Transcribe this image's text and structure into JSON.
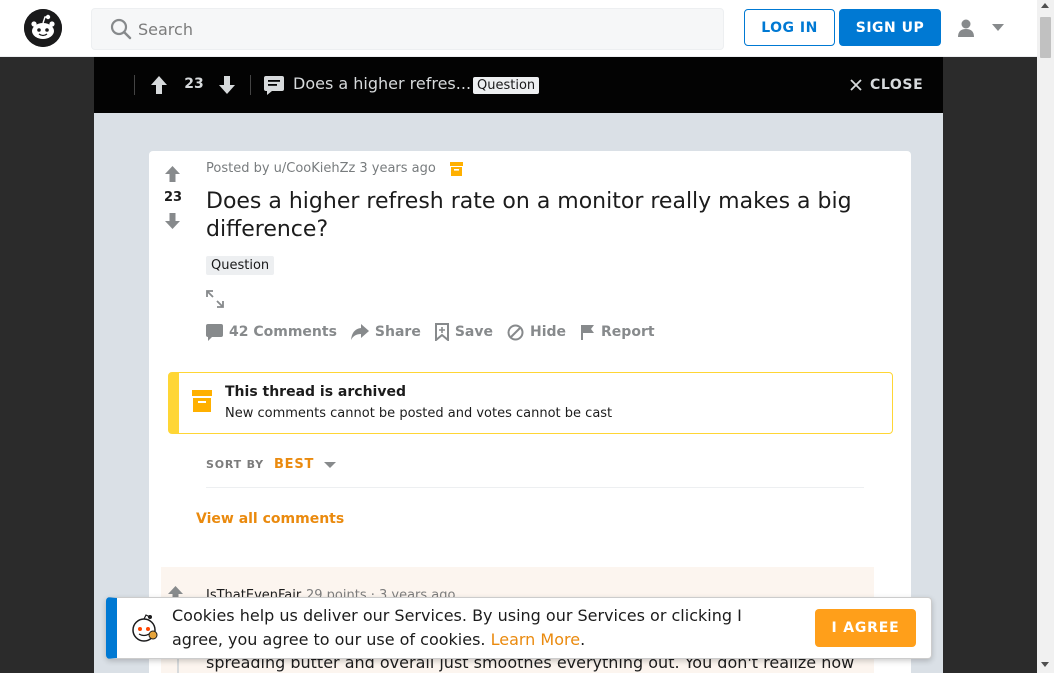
{
  "header": {
    "search_placeholder": "Search",
    "login_label": "LOG IN",
    "signup_label": "SIGN UP"
  },
  "postbar": {
    "score": "23",
    "title": "Does a higher refres...",
    "flair": "Question",
    "close_label": "CLOSE"
  },
  "post": {
    "posted_by": "Posted by u/CooKiehZz",
    "age": "3 years ago",
    "score": "23",
    "title": "Does a higher refresh rate on a monitor really makes a big difference?",
    "flair": "Question",
    "actions": {
      "comments": "42 Comments",
      "share": "Share",
      "save": "Save",
      "hide": "Hide",
      "report": "Report"
    }
  },
  "archived": {
    "title": "This thread is archived",
    "message": "New comments cannot be posted and votes cannot be cast"
  },
  "sort": {
    "label": "SORT BY",
    "value": "BEST"
  },
  "view_all": "View all comments",
  "comment": {
    "author": "IsThatEvenFair",
    "points": "29 points · 3 years ago",
    "body": "spreading butter and overall just smoothes everything out. You don't realize how"
  },
  "cookie": {
    "text": "Cookies help us deliver our Services. By using our Services or clicking I agree, you agree to our use of cookies.",
    "learn_more": "Learn More",
    "trailing": ".",
    "agree_label": "I AGREE"
  },
  "colors": {
    "brand_blue": "#0079d3",
    "orange": "#ea8a0e",
    "archived_yellow": "#ffd635"
  }
}
